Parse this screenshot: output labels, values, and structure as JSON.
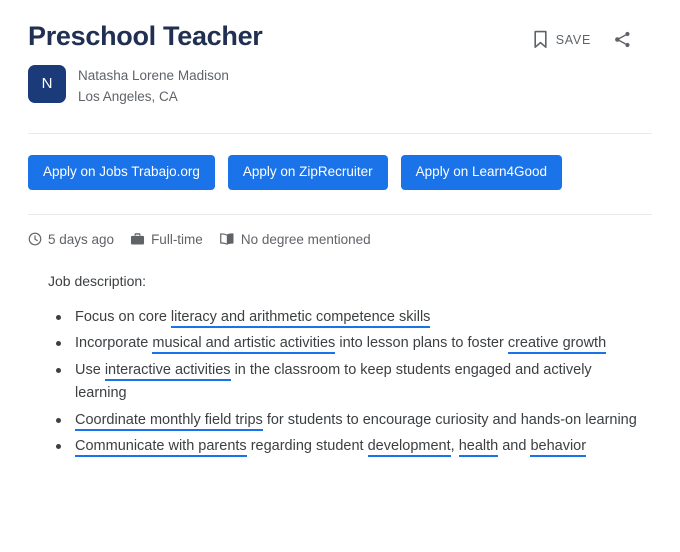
{
  "header": {
    "job_title": "Preschool Teacher",
    "save_label": "SAVE",
    "save_icon": "bookmark-icon",
    "share_icon": "share-icon"
  },
  "company": {
    "avatar_initial": "N",
    "avatar_color": "#1a3a7a",
    "name": "Natasha Lorene Madison",
    "location": "Los Angeles, CA"
  },
  "apply_buttons": [
    {
      "label": "Apply on Jobs Trabajo.org"
    },
    {
      "label": "Apply on ZipRecruiter"
    },
    {
      "label": "Apply on Learn4Good"
    }
  ],
  "meta": [
    {
      "icon": "clock-icon",
      "label": "5 days ago"
    },
    {
      "icon": "briefcase-icon",
      "label": "Full-time"
    },
    {
      "icon": "book-icon",
      "label": "No degree mentioned"
    }
  ],
  "description": {
    "label": "Job description:",
    "bullets": [
      {
        "parts": [
          {
            "text": "Focus on core ",
            "highlight": false
          },
          {
            "text": "literacy and arithmetic competence skills",
            "highlight": true
          }
        ]
      },
      {
        "parts": [
          {
            "text": "Incorporate ",
            "highlight": false
          },
          {
            "text": "musical and artistic activities",
            "highlight": true
          },
          {
            "text": " into lesson plans to foster ",
            "highlight": false
          },
          {
            "text": "creative growth",
            "highlight": true
          }
        ]
      },
      {
        "parts": [
          {
            "text": "Use ",
            "highlight": false
          },
          {
            "text": "interactive activities",
            "highlight": true
          },
          {
            "text": " in the classroom to keep students engaged and actively learning",
            "highlight": false
          }
        ]
      },
      {
        "parts": [
          {
            "text": "Coordinate monthly field trips",
            "highlight": true
          },
          {
            "text": " for students to encourage curiosity and hands-on learning",
            "highlight": false
          }
        ]
      },
      {
        "parts": [
          {
            "text": "Communicate with parents",
            "highlight": true
          },
          {
            "text": " regarding student ",
            "highlight": false
          },
          {
            "text": "development",
            "highlight": true
          },
          {
            "text": ", ",
            "highlight": false
          },
          {
            "text": "health",
            "highlight": true
          },
          {
            "text": " and ",
            "highlight": false
          },
          {
            "text": "behavior",
            "highlight": true
          }
        ]
      }
    ]
  },
  "colors": {
    "accent_blue": "#1a73e8",
    "title_navy": "#202f52",
    "text_gray": "#5f6368",
    "divider": "#e8eaed"
  }
}
